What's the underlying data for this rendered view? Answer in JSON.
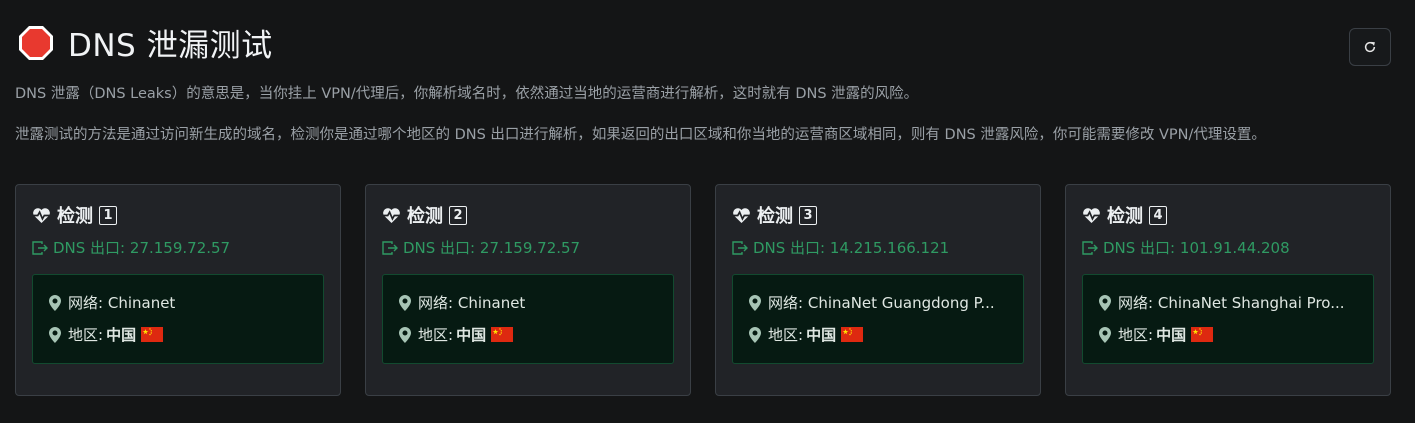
{
  "header": {
    "title": "DNS 泄漏测试",
    "icon": "stop-sign-icon",
    "accent": "#e8392f"
  },
  "description": {
    "p1": "DNS 泄露（DNS Leaks）的意思是，当你挂上 VPN/代理后，你解析域名时，依然通过当地的运营商进行解析，这时就有 DNS 泄露的风险。",
    "p2": "泄露测试的方法是通过访问新生成的域名，检测你是通过哪个地区的 DNS 出口进行解析，如果返回的出口区域和你当地的运营商区域相同，则有 DNS 泄露风险，你可能需要修改 VPN/代理设置。"
  },
  "refresh": {
    "icon": "refresh-icon"
  },
  "labels": {
    "check": "检测",
    "dns_exit": "DNS 出口:",
    "network": "网络:",
    "region": "地区:"
  },
  "colors": {
    "green": "#2f9a63",
    "card_bg": "#212327",
    "inner_bg": "#061a12"
  },
  "tests": [
    {
      "number": "1",
      "ip": "27.159.72.57",
      "network": "Chinanet",
      "country": "中国"
    },
    {
      "number": "2",
      "ip": "27.159.72.57",
      "network": "Chinanet",
      "country": "中国"
    },
    {
      "number": "3",
      "ip": "14.215.166.121",
      "network": "ChinaNet Guangdong P...",
      "country": "中国"
    },
    {
      "number": "4",
      "ip": "101.91.44.208",
      "network": "ChinaNet Shanghai Pro...",
      "country": "中国"
    }
  ]
}
